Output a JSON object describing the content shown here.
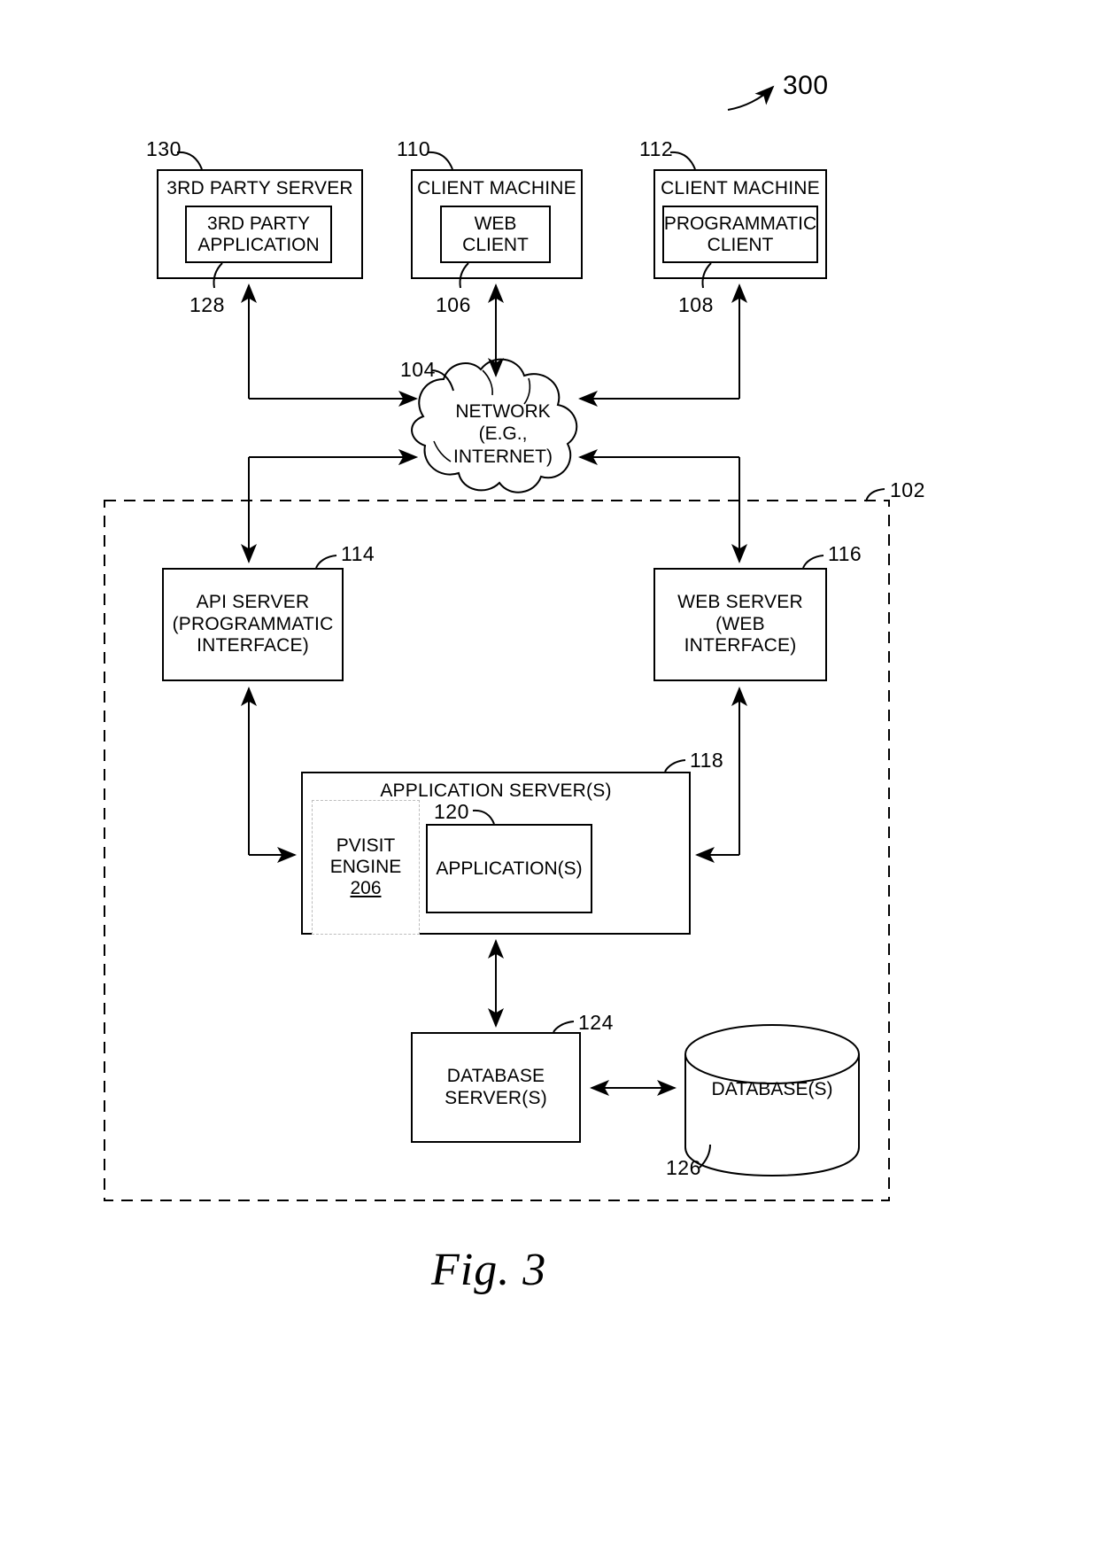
{
  "figure": {
    "caption": "Fig. 3",
    "figure_ref": "300",
    "system_boundary_ref": "102"
  },
  "nodes": {
    "third_party_server": {
      "title": "3RD PARTY SERVER",
      "ref": "130",
      "inner": {
        "label": "3RD PARTY\nAPPLICATION",
        "ref": "128"
      }
    },
    "client_machine_web": {
      "title": "CLIENT MACHINE",
      "ref": "110",
      "inner": {
        "label": "WEB\nCLIENT",
        "ref": "106"
      }
    },
    "client_machine_prog": {
      "title": "CLIENT MACHINE",
      "ref": "112",
      "inner": {
        "label": "PROGRAMMATIC\nCLIENT",
        "ref": "108"
      }
    },
    "network": {
      "label": "NETWORK\n(E.G.,\nINTERNET)",
      "ref": "104"
    },
    "api_server": {
      "label": "API SERVER\n(PROGRAMMATIC\nINTERFACE)",
      "ref": "114"
    },
    "web_server": {
      "label": "WEB SERVER\n(WEB\nINTERFACE)",
      "ref": "116"
    },
    "application_server": {
      "title": "APPLICATION SERVER(S)",
      "ref": "118",
      "pvisit_engine": {
        "line1": "PVISIT",
        "line2": "ENGINE",
        "ref": "206"
      },
      "applications": {
        "label": "APPLICATION(S)",
        "ref": "120"
      }
    },
    "database_server": {
      "label": "DATABASE\nSERVER(S)",
      "ref": "124"
    },
    "databases": {
      "label": "DATABASE(S)",
      "ref": "126"
    }
  }
}
